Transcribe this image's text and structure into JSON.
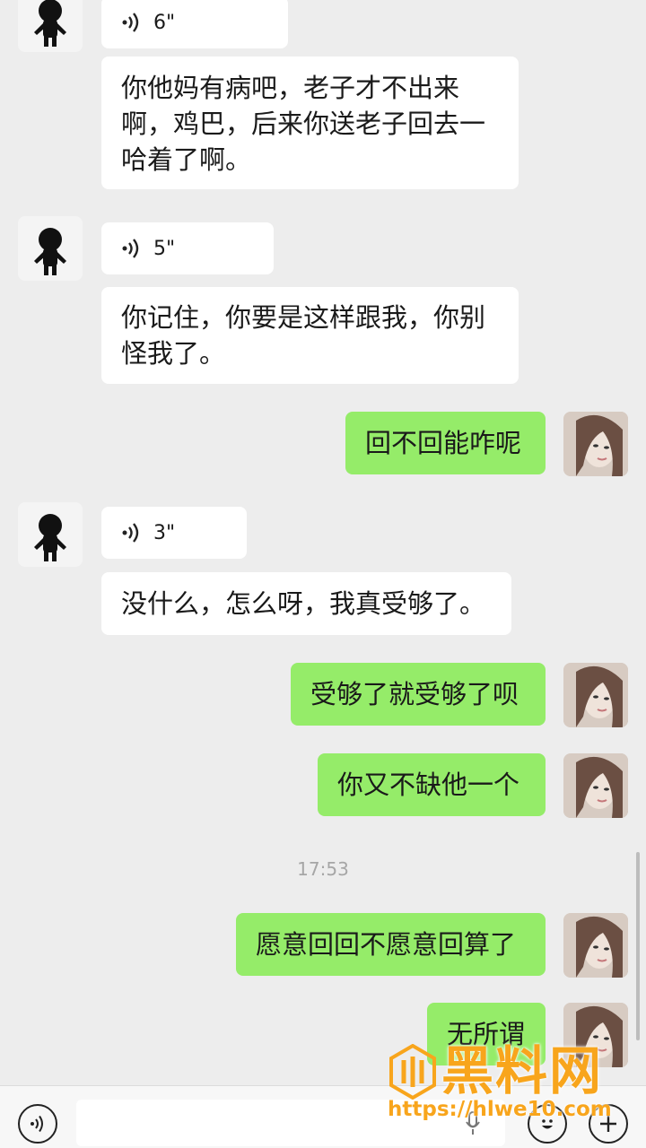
{
  "messages": [
    {
      "side": "left",
      "type": "voice",
      "duration": "6\""
    },
    {
      "side": "left",
      "type": "text",
      "text": "你他妈有病吧，老子才不出来啊，鸡巴，后来你送老子回去一哈着了啊。"
    },
    {
      "side": "left",
      "type": "voice",
      "duration": "5\""
    },
    {
      "side": "left",
      "type": "text",
      "text": "你记住，你要是这样跟我，你别怪我了。"
    },
    {
      "side": "right",
      "type": "text",
      "text": "回不回能咋呢"
    },
    {
      "side": "left",
      "type": "voice",
      "duration": "3\""
    },
    {
      "side": "left",
      "type": "text",
      "text": "没什么，怎么呀，我真受够了。"
    },
    {
      "side": "right",
      "type": "text",
      "text": "受够了就受够了呗"
    },
    {
      "side": "right",
      "type": "text",
      "text": "你又不缺他一个"
    },
    {
      "side": "right",
      "type": "text",
      "text": "愿意回回不愿意回算了"
    },
    {
      "side": "right",
      "type": "text",
      "text": "无所谓"
    }
  ],
  "timestamp": "17:53",
  "watermark": {
    "title": "黑料网",
    "url": "https://hlwe10.com"
  },
  "colors": {
    "sent_bubble": "#95ec69",
    "received_bubble": "#ffffff",
    "background": "#ededed",
    "watermark": "#f8a51c"
  },
  "input_bar": {
    "voice_button": "voice-icon",
    "emoji_button": "emoji-icon",
    "more_button": "plus-icon"
  }
}
